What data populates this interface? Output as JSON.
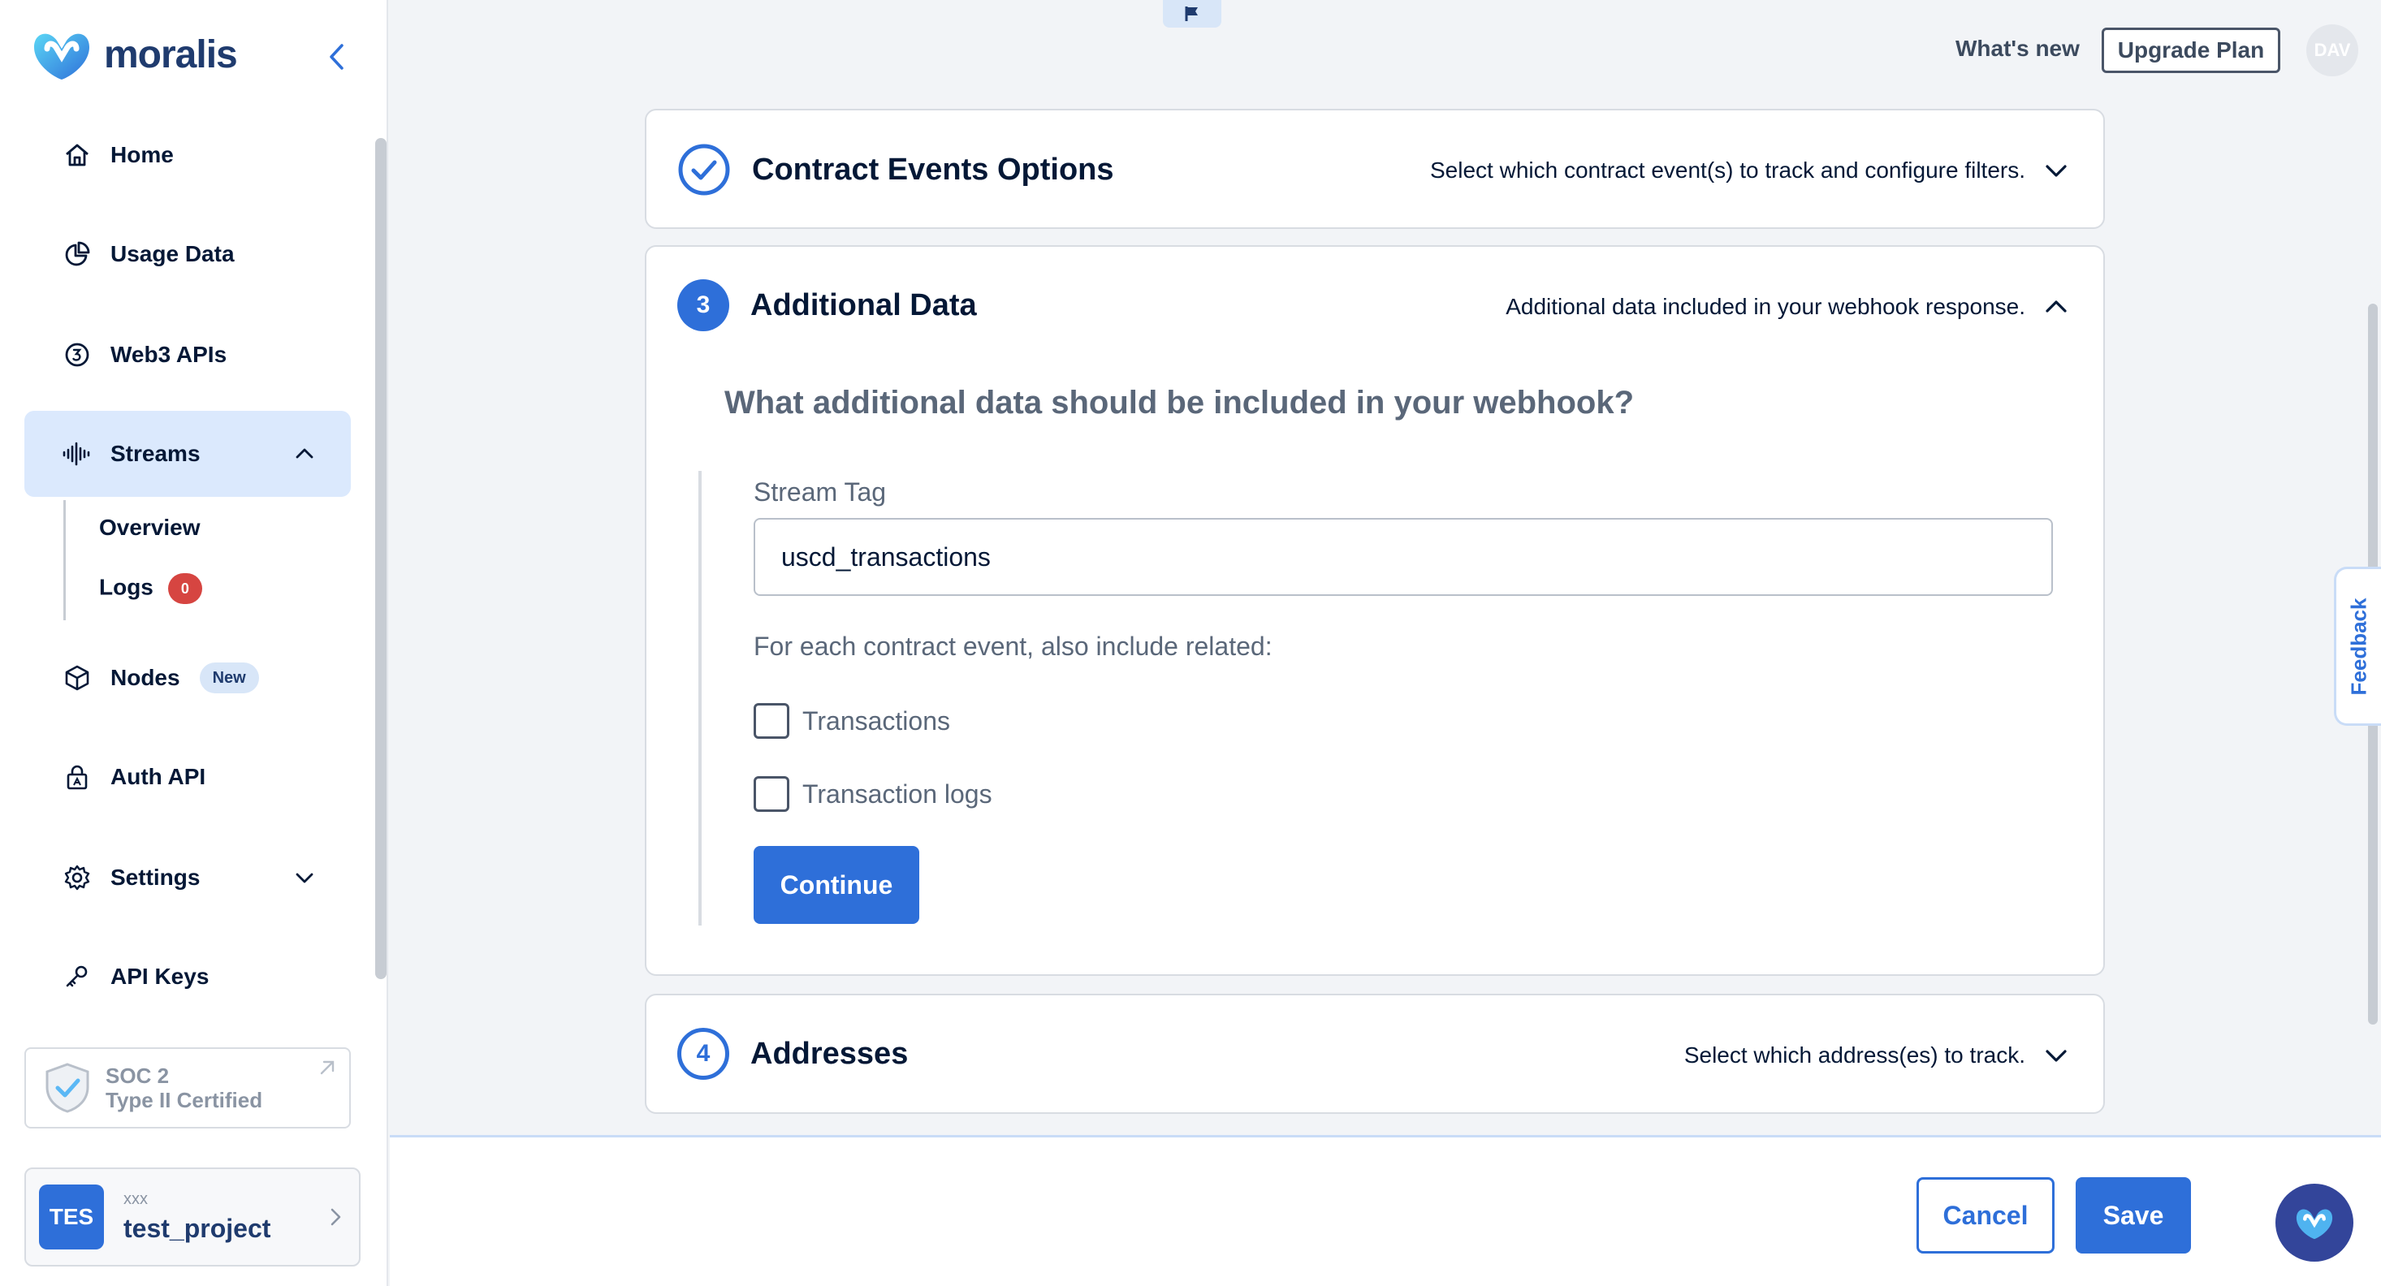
{
  "brand": {
    "name": "moralis"
  },
  "sidebar": {
    "items": [
      {
        "label": "Home",
        "icon": "home-icon"
      },
      {
        "label": "Usage Data",
        "icon": "pie-chart-icon"
      },
      {
        "label": "Web3 APIs",
        "icon": "coin-icon"
      },
      {
        "label": "Streams",
        "icon": "waveform-icon",
        "expanded": true
      },
      {
        "label": "Nodes",
        "icon": "cube-icon",
        "badge": "New"
      },
      {
        "label": "Auth API",
        "icon": "lock-icon"
      },
      {
        "label": "Settings",
        "icon": "gear-icon",
        "expanded": false
      },
      {
        "label": "API Keys",
        "icon": "key-icon"
      }
    ],
    "streams_sub": [
      {
        "label": "Overview"
      },
      {
        "label": "Logs",
        "count": "0"
      }
    ],
    "soc": {
      "line1": "SOC 2",
      "line2": "Type II Certified"
    },
    "project": {
      "initials": "TES",
      "org": "xxx",
      "name": "test_project"
    }
  },
  "topbar": {
    "whats_new": "What's new",
    "upgrade": "Upgrade Plan",
    "avatar": "DAV"
  },
  "panels": {
    "contract_events": {
      "title": "Contract Events Options",
      "desc": "Select which contract event(s) to track and configure filters.",
      "state": "completed"
    },
    "additional_data": {
      "step": "3",
      "title": "Additional Data",
      "desc": "Additional data included in your webhook response.",
      "question": "What additional data should be included in your webhook?",
      "stream_tag_label": "Stream Tag",
      "stream_tag_value": "uscd_transactions",
      "include_label": "For each contract event, also include related:",
      "options": [
        {
          "label": "Transactions",
          "checked": false
        },
        {
          "label": "Transaction logs",
          "checked": false
        }
      ],
      "continue": "Continue"
    },
    "addresses": {
      "step": "4",
      "title": "Addresses",
      "desc": "Select which address(es) to track."
    }
  },
  "feedback": "Feedback",
  "footer": {
    "cancel": "Cancel",
    "save": "Save"
  },
  "colors": {
    "accent": "#2e6fd9",
    "navy": "#041836",
    "active_bg": "#dbe9fd",
    "danger": "#d64541"
  }
}
